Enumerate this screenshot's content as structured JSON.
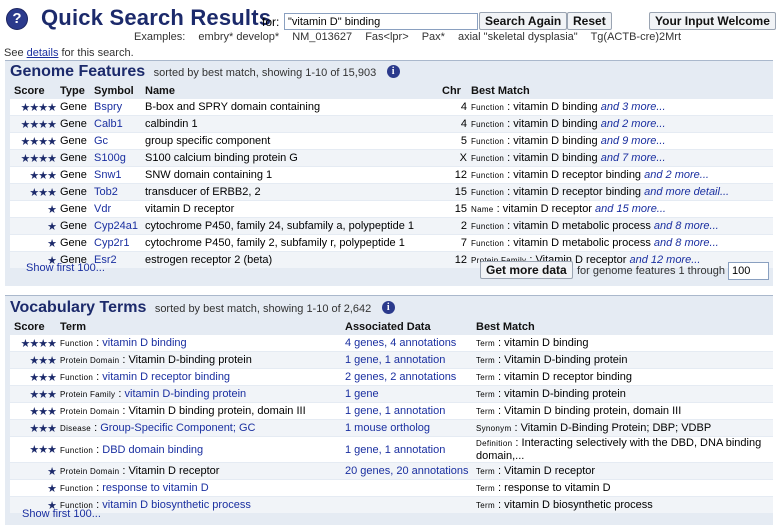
{
  "header": {
    "help_icon": "?",
    "title": "Quick Search Results",
    "for_label": "for:",
    "query": "\"vitamin D\" binding",
    "search_again": "Search Again",
    "reset": "Reset",
    "your_input": "Your Input Welcome",
    "examples_label": "Examples:",
    "examples": [
      "embry* develop*",
      "NM_013627",
      "Fas<lpr>",
      "Pax*",
      "axial \"skeletal dysplasia\"",
      "Tg(ACTB-cre)2Mrt"
    ],
    "see_pre": "See",
    "see_link": "details",
    "see_post": "for this search."
  },
  "genome": {
    "title": "Genome Features",
    "subtitle": "sorted by best match, showing 1-10 of 15,903",
    "columns": [
      "Score",
      "Type",
      "Symbol",
      "Name",
      "Chr",
      "Best Match"
    ],
    "rows": [
      {
        "score": "★★★★",
        "type": "Gene",
        "symbol": "Bspry",
        "name": "B-box and SPRY domain containing",
        "chr": "4",
        "match_type": "Function",
        "match": "vitamin D binding",
        "more": "and 3 more..."
      },
      {
        "score": "★★★★",
        "type": "Gene",
        "symbol": "Calb1",
        "name": "calbindin 1",
        "chr": "4",
        "match_type": "Function",
        "match": "vitamin D binding",
        "more": "and 2 more..."
      },
      {
        "score": "★★★★",
        "type": "Gene",
        "symbol": "Gc",
        "name": "group specific component",
        "chr": "5",
        "match_type": "Function",
        "match": "vitamin D binding",
        "more": "and 9 more..."
      },
      {
        "score": "★★★★",
        "type": "Gene",
        "symbol": "S100g",
        "name": "S100 calcium binding protein G",
        "chr": "X",
        "match_type": "Function",
        "match": "vitamin D binding",
        "more": "and 7 more..."
      },
      {
        "score": "★★★",
        "type": "Gene",
        "symbol": "Snw1",
        "name": "SNW domain containing 1",
        "chr": "12",
        "match_type": "Function",
        "match": "vitamin D receptor binding",
        "more": "and 2 more..."
      },
      {
        "score": "★★★",
        "type": "Gene",
        "symbol": "Tob2",
        "name": "transducer of ERBB2, 2",
        "chr": "15",
        "match_type": "Function",
        "match": "vitamin D receptor binding",
        "more": "and more detail..."
      },
      {
        "score": "★",
        "type": "Gene",
        "symbol": "Vdr",
        "name": "vitamin D receptor",
        "chr": "15",
        "match_type": "Name",
        "match": "vitamin D receptor",
        "more": "and 15 more..."
      },
      {
        "score": "★",
        "type": "Gene",
        "symbol": "Cyp24a1",
        "name": "cytochrome P450, family 24, subfamily a, polypeptide 1",
        "chr": "2",
        "match_type": "Function",
        "match": "vitamin D metabolic process",
        "more": "and 8 more..."
      },
      {
        "score": "★",
        "type": "Gene",
        "symbol": "Cyp2r1",
        "name": "cytochrome P450, family 2, subfamily r, polypeptide 1",
        "chr": "7",
        "match_type": "Function",
        "match": "vitamin D metabolic process",
        "more": "and 8 more..."
      },
      {
        "score": "★",
        "type": "Gene",
        "symbol": "Esr2",
        "name": "estrogen receptor 2 (beta)",
        "chr": "12",
        "match_type": "Protein Family",
        "match": "Vitamin D receptor",
        "more": "and 12 more..."
      }
    ],
    "show_first": "Show first 100...",
    "get_more": "Get more data",
    "through_label": "for genome features 1 through",
    "through_value": "100"
  },
  "vocab": {
    "title": "Vocabulary Terms",
    "subtitle": "sorted by best match, showing 1-10 of 2,642",
    "columns": [
      "Score",
      "Term",
      "Associated Data",
      "Best Match"
    ],
    "rows": [
      {
        "score": "★★★★",
        "term_type": "Function",
        "term": "vitamin D binding",
        "term_link": true,
        "assoc": "4 genes, 4 annotations",
        "match_type": "Term",
        "match": "vitamin D binding"
      },
      {
        "score": "★★★",
        "term_type": "Protein Domain",
        "term": "Vitamin D-binding protein",
        "term_link": false,
        "assoc": "1 gene, 1 annotation",
        "match_type": "Term",
        "match": "Vitamin D-binding protein"
      },
      {
        "score": "★★★",
        "term_type": "Function",
        "term": "vitamin D receptor binding",
        "term_link": true,
        "assoc": "2 genes, 2 annotations",
        "match_type": "Term",
        "match": "vitamin D receptor binding"
      },
      {
        "score": "★★★",
        "term_type": "Protein Family",
        "term": "vitamin D-binding protein",
        "term_link": true,
        "assoc": "1 gene",
        "match_type": "Term",
        "match": "vitamin D-binding protein"
      },
      {
        "score": "★★★",
        "term_type": "Protein Domain",
        "term": "Vitamin D binding protein, domain III",
        "term_link": false,
        "assoc": "1 gene, 1 annotation",
        "match_type": "Term",
        "match": "Vitamin D binding protein, domain III"
      },
      {
        "score": "★★★",
        "term_type": "Disease",
        "term": "Group-Specific Component; GC",
        "term_link": true,
        "assoc": "1 mouse ortholog",
        "match_type": "Synonym",
        "match": "Vitamin D-Binding Protein; DBP; VDBP"
      },
      {
        "score": "★★★",
        "term_type": "Function",
        "term": "DBD domain binding",
        "term_link": true,
        "assoc": "1 gene, 1 annotation",
        "match_type": "Definition",
        "match": "Interacting selectively with the DBD, DNA binding domain,..."
      },
      {
        "score": "★",
        "term_type": "Protein Domain",
        "term": "Vitamin D receptor",
        "term_link": false,
        "assoc": "20 genes, 20 annotations",
        "match_type": "Term",
        "match": "Vitamin D receptor"
      },
      {
        "score": "★",
        "term_type": "Function",
        "term": "response to vitamin D",
        "term_link": true,
        "assoc": "",
        "match_type": "Term",
        "match": "response to vitamin D"
      },
      {
        "score": "★",
        "term_type": "Function",
        "term": "vitamin D biosynthetic process",
        "term_link": true,
        "assoc": "",
        "match_type": "Term",
        "match": "vitamin D biosynthetic process"
      }
    ],
    "show_first": "Show first 100..."
  },
  "colors": {
    "accent": "#1c2a6b",
    "link": "#1a2fa0",
    "panel": "#e5ebf3"
  },
  "icons": {
    "help": "help-icon",
    "info": "info-icon",
    "star": "star-icon"
  }
}
